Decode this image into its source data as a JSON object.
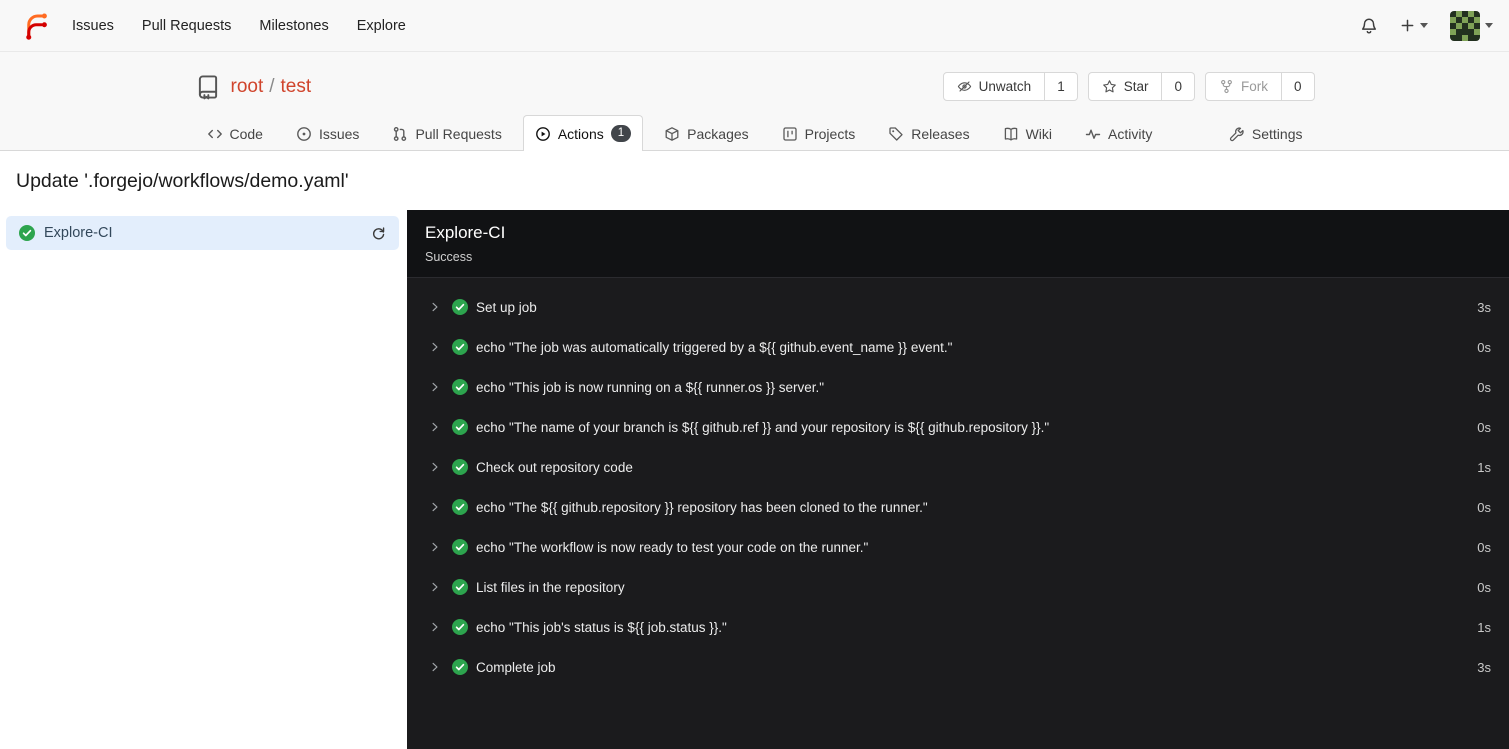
{
  "navbar": {
    "items": [
      {
        "label": "Issues"
      },
      {
        "label": "Pull Requests"
      },
      {
        "label": "Milestones"
      },
      {
        "label": "Explore"
      }
    ]
  },
  "repo_header": {
    "owner": "root",
    "separator": "/",
    "name": "test",
    "actions": [
      {
        "label": "Unwatch",
        "count": "1"
      },
      {
        "label": "Star",
        "count": "0"
      },
      {
        "label": "Fork",
        "count": "0"
      }
    ]
  },
  "tabs": [
    {
      "label": "Code"
    },
    {
      "label": "Issues"
    },
    {
      "label": "Pull Requests"
    },
    {
      "label": "Actions",
      "badge": "1",
      "active": true
    },
    {
      "label": "Packages"
    },
    {
      "label": "Projects"
    },
    {
      "label": "Releases"
    },
    {
      "label": "Wiki"
    },
    {
      "label": "Activity"
    }
  ],
  "settings_tab": {
    "label": "Settings"
  },
  "run": {
    "title": "Update '.forgejo/workflows/demo.yaml'",
    "job": {
      "name": "Explore-CI",
      "status": "success"
    },
    "panel": {
      "title": "Explore-CI",
      "status": "Success",
      "steps": [
        {
          "name": "Set up job",
          "duration": "3s"
        },
        {
          "name": "echo \"The job was automatically triggered by a ${{ github.event_name }} event.\"",
          "duration": "0s"
        },
        {
          "name": "echo \"This job is now running on a ${{ runner.os }} server.\"",
          "duration": "0s"
        },
        {
          "name": "echo \"The name of your branch is ${{ github.ref }} and your repository is ${{ github.repository }}.\"",
          "duration": "0s"
        },
        {
          "name": "Check out repository code",
          "duration": "1s"
        },
        {
          "name": "echo \"The ${{ github.repository }} repository has been cloned to the runner.\"",
          "duration": "0s"
        },
        {
          "name": "echo \"The workflow is now ready to test your code on the runner.\"",
          "duration": "0s"
        },
        {
          "name": "List files in the repository",
          "duration": "0s"
        },
        {
          "name": "echo \"This job's status is ${{ job.status }}.\"",
          "duration": "1s"
        },
        {
          "name": "Complete job",
          "duration": "3s"
        }
      ]
    }
  },
  "colors": {
    "brand_orange": "#d0442c",
    "success_green": "#2da44e",
    "job_selected_bg": "#e3eefc",
    "log_panel_bg": "#1b1b1d",
    "log_header_bg": "#111214"
  }
}
